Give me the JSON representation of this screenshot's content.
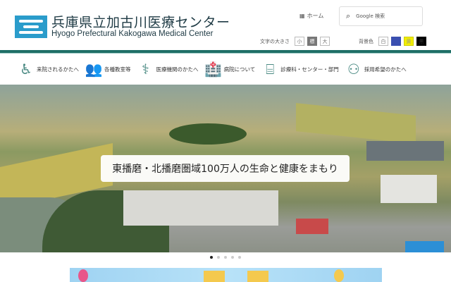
{
  "header": {
    "title": "兵庫県立加古川医療センター",
    "subtitle": "Hyogo Prefectural Kakogawa Medical Center",
    "home_label": "ホーム",
    "search_placeholder": "Google 検索"
  },
  "font_size": {
    "label": "文字の大きさ",
    "options": [
      "小",
      "標",
      "大"
    ],
    "selected": "標"
  },
  "bg_color": {
    "label": "背景色",
    "options": [
      {
        "label": "白",
        "color": "#ffffff"
      },
      {
        "label": "青",
        "color": "#3a4fb0"
      },
      {
        "label": "黄",
        "color": "#f2ee00"
      },
      {
        "label": "黒",
        "color": "#000000"
      }
    ]
  },
  "nav": [
    {
      "label": "来院されるかたへ",
      "icon": "wheelchair-icon"
    },
    {
      "label": "各種教室等",
      "icon": "people-icon"
    },
    {
      "label": "医療機関のかたへ",
      "icon": "doctors-icon"
    },
    {
      "label": "病院について",
      "icon": "hospital-icon"
    },
    {
      "label": "診療科・センター・部門",
      "icon": "reception-icon"
    },
    {
      "label": "採用希望のかたへ",
      "icon": "staff-icon"
    }
  ],
  "hero": {
    "caption": "東播磨・北播磨圏域100万人の生命と健康をまもり",
    "slides": 5,
    "active_slide": 1
  },
  "colors": {
    "accent": "#1f6f67",
    "logo": "#2a9ccb"
  }
}
